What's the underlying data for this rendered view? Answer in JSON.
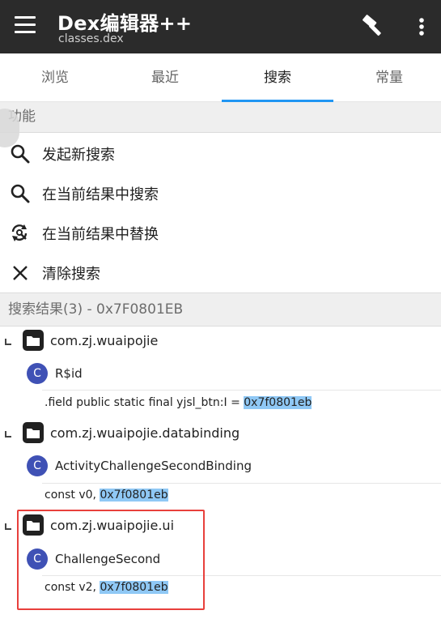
{
  "appbar": {
    "title": "Dex编辑器++",
    "subtitle": "classes.dex",
    "menu_icon": "hamburger-menu-icon",
    "build_icon": "hammer-icon",
    "more_icon": "more-vert-icon"
  },
  "tabs": [
    {
      "label": "浏览",
      "active": false
    },
    {
      "label": "最近",
      "active": false
    },
    {
      "label": "搜索",
      "active": true
    },
    {
      "label": "常量",
      "active": false
    }
  ],
  "functions": {
    "header": "功能",
    "items": [
      {
        "label": "发起新搜索",
        "icon": "search-icon"
      },
      {
        "label": "在当前结果中搜索",
        "icon": "search-icon"
      },
      {
        "label": "在当前结果中替换",
        "icon": "replace-icon"
      },
      {
        "label": "清除搜索",
        "icon": "close-icon"
      }
    ]
  },
  "results": {
    "header": "搜索结果(3) - 0x7F0801EB",
    "groups": [
      {
        "package": "com.zj.wuaipojie",
        "class_badge": "C",
        "class_name": "R$id",
        "code_prefix": ".field public static final yjsl_btn:I = ",
        "code_match": "0x7f0801eb"
      },
      {
        "package": "com.zj.wuaipojie.databinding",
        "class_badge": "C",
        "class_name": "ActivityChallengeSecondBinding",
        "code_prefix": "const v0, ",
        "code_match": "0x7f0801eb"
      },
      {
        "package": "com.zj.wuaipojie.ui",
        "class_badge": "C",
        "class_name": "ChallengeSecond",
        "code_prefix": "const v2, ",
        "code_match": "0x7f0801eb"
      }
    ]
  },
  "colors": {
    "appbar": "#2b2b2b",
    "tab_indicator": "#2196f3",
    "class_badge": "#3f51b5",
    "highlight": "#8fc8f5",
    "annotation_box": "#e8403c"
  }
}
